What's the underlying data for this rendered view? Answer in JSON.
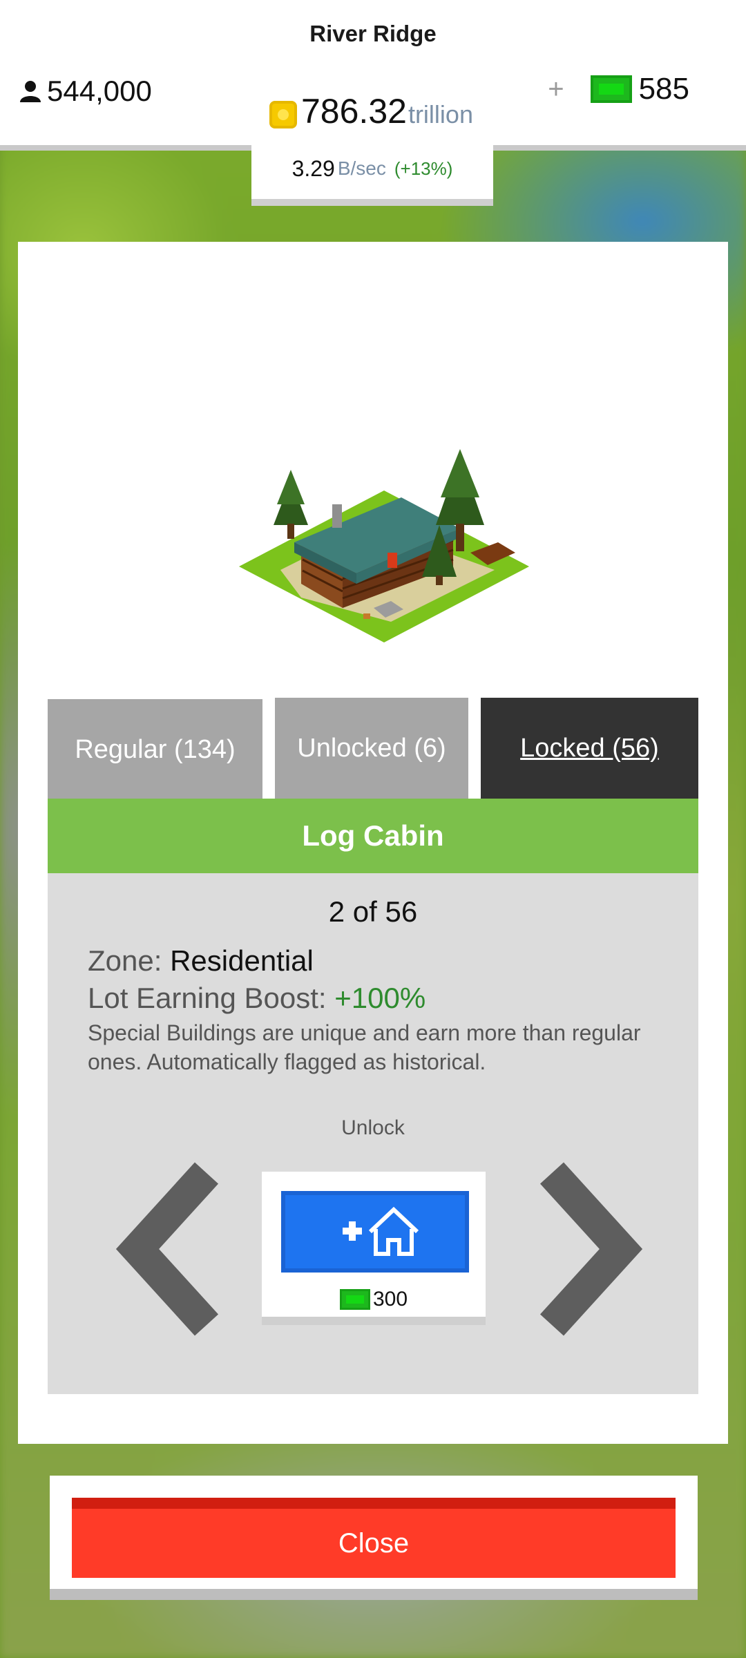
{
  "hud": {
    "city_name": "River Ridge",
    "population": "544,000",
    "coins_value": "786.32",
    "coins_unit": "trillion",
    "gems_plus": "+",
    "gems_count": "585",
    "rate_value": "3.29",
    "rate_unit": "B/sec",
    "rate_pct": "(+13%)"
  },
  "tabs": {
    "regular": "Regular (134)",
    "unlocked": "Unlocked (6)",
    "locked": "Locked (56)",
    "active": "locked"
  },
  "building": {
    "name": "Log Cabin",
    "counter": "2 of 56",
    "zone_label": "Zone: ",
    "zone_value": "Residential",
    "boost_label": "Lot Earning Boost: ",
    "boost_value": "+100%",
    "description": "Special Buildings are unique and earn more than regular ones. Automatically flagged as historical."
  },
  "unlock": {
    "label": "Unlock",
    "cost": "300"
  },
  "close_label": "Close",
  "colors": {
    "header_green": "#7cc04b",
    "unlock_blue": "#1e74f0",
    "close_red": "#ff3b28",
    "gem_green": "#1db81d",
    "coin_yellow": "#f6c900"
  },
  "icons": [
    "person-icon",
    "coin-icon",
    "gem-icon",
    "chevron-left-icon",
    "chevron-right-icon",
    "add-house-icon"
  ]
}
